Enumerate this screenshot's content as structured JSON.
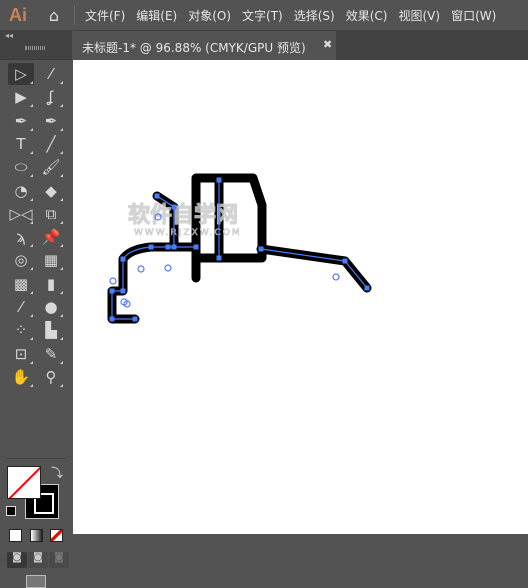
{
  "app": {
    "logo": "Ai",
    "home_icon": "home-icon"
  },
  "menu": [
    "文件(F)",
    "编辑(E)",
    "对象(O)",
    "文字(T)",
    "选择(S)",
    "效果(C)",
    "视图(V)",
    "窗口(W)"
  ],
  "panel": {
    "collapse": "◂◂"
  },
  "tab": {
    "title": "未标题-1* @ 96.88% (CMYK/GPU 预览)",
    "close": "✖"
  },
  "tools": [
    {
      "name": "selection-tool",
      "glyph": "▷"
    },
    {
      "name": "magic-wand-tool",
      "glyph": "⁄"
    },
    {
      "name": "direct-selection-tool",
      "glyph": "▶"
    },
    {
      "name": "lasso-tool",
      "glyph": "ʆ"
    },
    {
      "name": "pen-tool",
      "glyph": "✒"
    },
    {
      "name": "curvature-tool",
      "glyph": "✒"
    },
    {
      "name": "type-tool",
      "glyph": "T"
    },
    {
      "name": "line-tool",
      "glyph": "╱"
    },
    {
      "name": "ellipse-tool",
      "glyph": "⬭"
    },
    {
      "name": "paintbrush-tool",
      "glyph": "🖌"
    },
    {
      "name": "shaper-tool",
      "glyph": "◔"
    },
    {
      "name": "eraser-tool",
      "glyph": "◆"
    },
    {
      "name": "reflect-tool",
      "glyph": "▷◁"
    },
    {
      "name": "scale-tool",
      "glyph": "⧉"
    },
    {
      "name": "warp-tool",
      "glyph": "ϡ"
    },
    {
      "name": "puppet-warp-tool",
      "glyph": "📌"
    },
    {
      "name": "shape-builder-tool",
      "glyph": "◎"
    },
    {
      "name": "perspective-grid-tool",
      "glyph": "▦"
    },
    {
      "name": "mesh-tool",
      "glyph": "▩"
    },
    {
      "name": "gradient-tool",
      "glyph": "▮"
    },
    {
      "name": "eyedropper-tool",
      "glyph": "⁄"
    },
    {
      "name": "blend-tool",
      "glyph": "●"
    },
    {
      "name": "symbol-sprayer-tool",
      "glyph": "⁘"
    },
    {
      "name": "column-graph-tool",
      "glyph": "▙"
    },
    {
      "name": "artboard-tool",
      "glyph": "⊡"
    },
    {
      "name": "slice-tool",
      "glyph": "✎"
    },
    {
      "name": "hand-tool",
      "glyph": "✋"
    },
    {
      "name": "zoom-tool",
      "glyph": "⚲"
    }
  ],
  "canvas": {
    "accent": "#4a7cf7",
    "watermark": {
      "main": "软件自学网",
      "url": "WWW.RJZXW.COM"
    }
  }
}
